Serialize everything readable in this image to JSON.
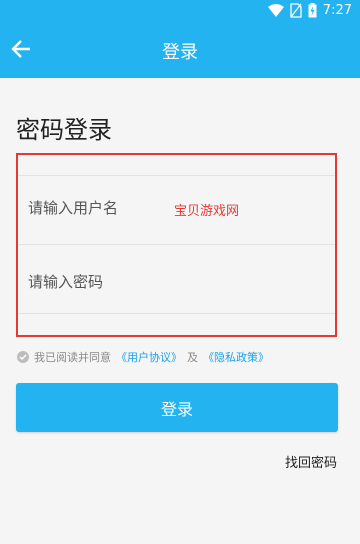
{
  "status_bar": {
    "time": "7:27"
  },
  "app_bar": {
    "title": "登录"
  },
  "heading": "密码登录",
  "form": {
    "username_placeholder": "请输入用户名",
    "password_placeholder": "请输入密码"
  },
  "watermark": "宝贝游戏网",
  "agreement": {
    "prefix": "我已阅读并同意",
    "user_agreement": "《用户协议》",
    "and": "及",
    "privacy_policy": "《隐私政策》"
  },
  "login_button": "登录",
  "forgot_password": "找回密码",
  "colors": {
    "primary": "#22b3f0",
    "highlight_border": "#e53935",
    "link": "#1aa2e8"
  }
}
